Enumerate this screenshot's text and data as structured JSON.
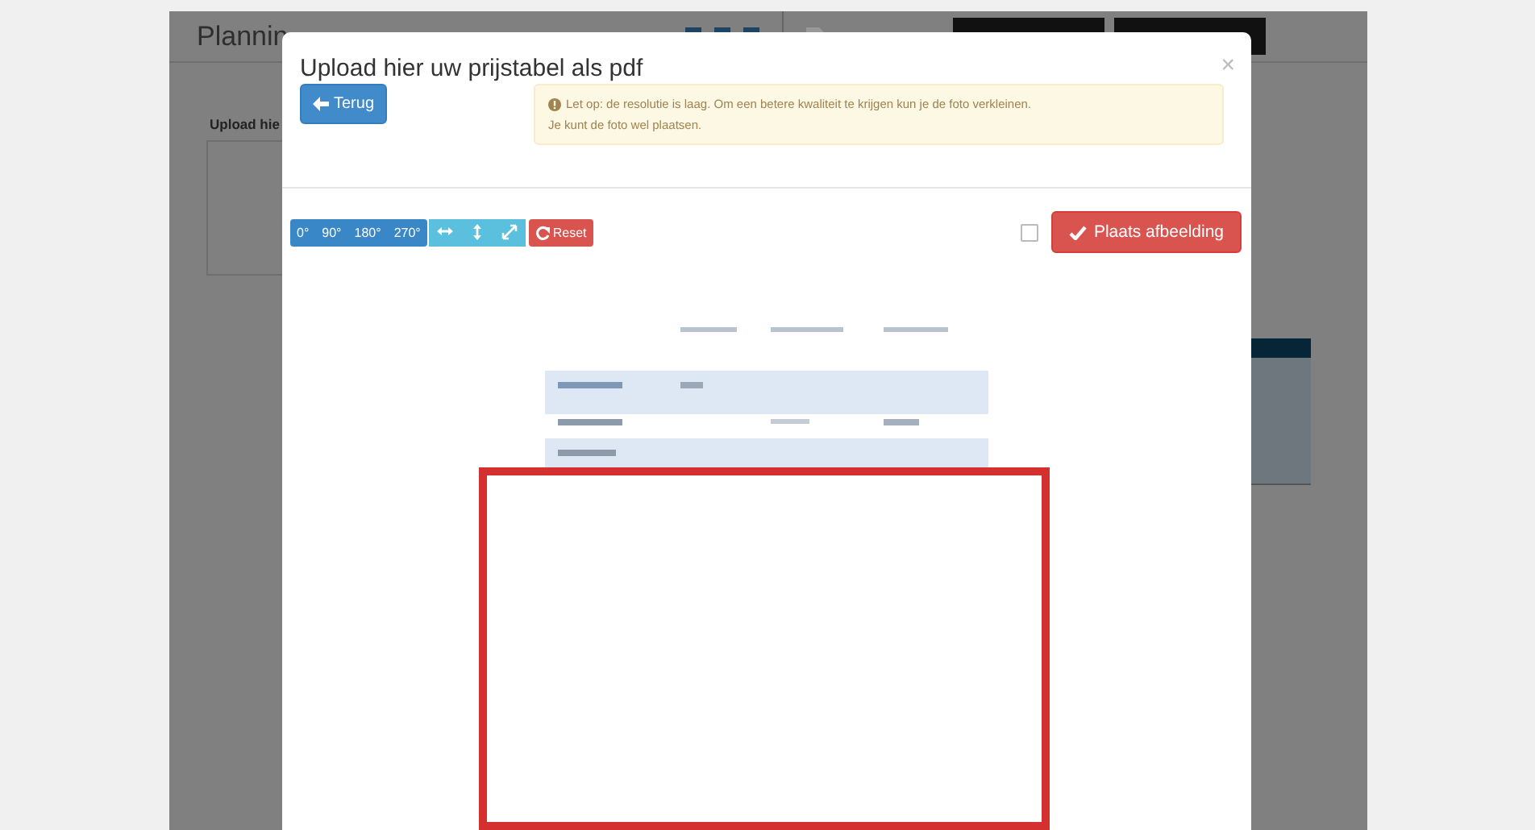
{
  "background_page": {
    "title": "Plannin",
    "section_label": "Upload hie"
  },
  "modal": {
    "title": "Upload hier uw prijstabel als pdf",
    "close": "×",
    "back_button": "Terug",
    "alert": {
      "lines": [
        "Let op: de resolutie is laag. Om een betere kwaliteit te krijgen kun je de foto verkleinen.",
        "Je kunt de foto wel plaatsen."
      ]
    },
    "rotate_buttons": [
      {
        "label": "0°"
      },
      {
        "label": "90°"
      },
      {
        "label": "180°"
      },
      {
        "label": "270°"
      }
    ],
    "transform_buttons": [
      {
        "kind": "flip-horizontal"
      },
      {
        "kind": "flip-vertical"
      },
      {
        "kind": "resize"
      }
    ],
    "reset_button": "Reset",
    "checkbox": {
      "checked": false
    },
    "place_button": "Plaats afbeelding",
    "preview": {
      "kind": "picture",
      "highlight": true
    }
  }
}
